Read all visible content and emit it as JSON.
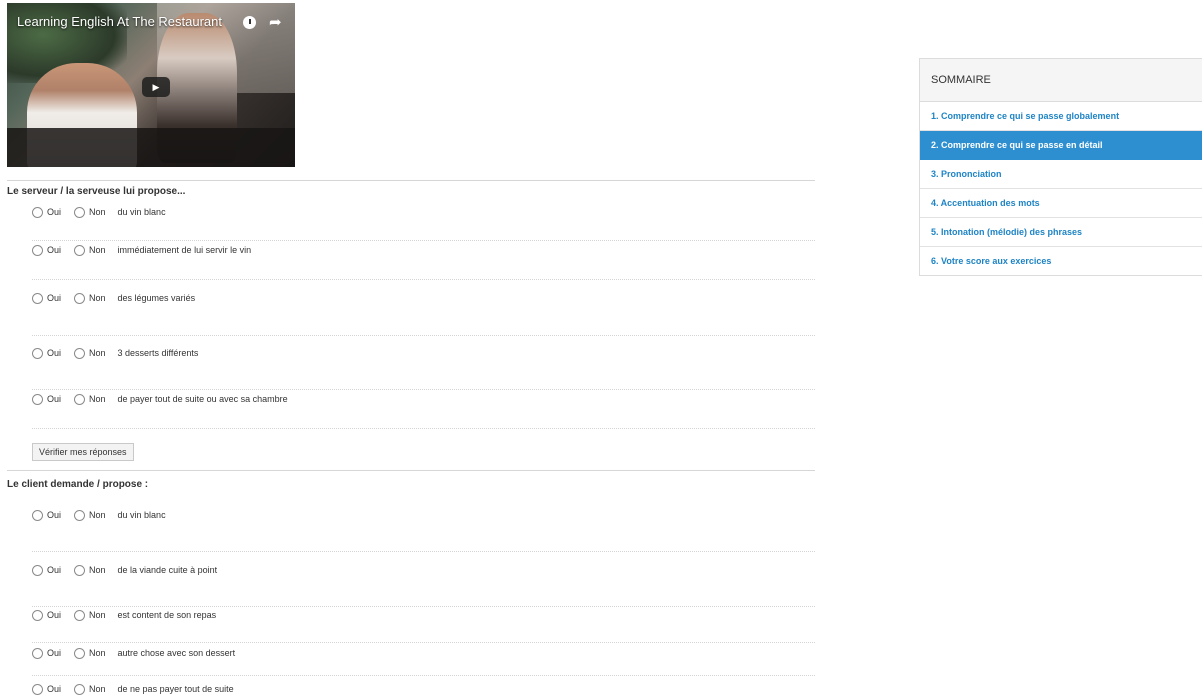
{
  "video": {
    "title": "Learning English At The Restaurant",
    "play_icon": "▶",
    "share_icon": "➦"
  },
  "section1": {
    "title": "Le serveur / la serveuse lui propose...",
    "items": [
      "du vin blanc",
      "immédiatement de lui servir le vin",
      "des légumes variés",
      "3 desserts différents",
      "de payer tout de suite ou avec sa chambre"
    ],
    "button_label": "Vérifier mes réponses"
  },
  "section2": {
    "title": "Le client demande / propose :",
    "items": [
      "du vin blanc",
      "de la viande cuite à point",
      "est content de son repas",
      "autre chose avec son dessert",
      "de ne pas payer tout de suite"
    ]
  },
  "options": {
    "yes": "Oui",
    "no": "Non"
  },
  "sidebar": {
    "title": "SOMMAIRE",
    "active_index": 1,
    "items": [
      "1. Comprendre ce qui se passe globalement",
      "2. Comprendre ce qui se passe en détail",
      "3. Prononciation",
      "4. Accentuation des mots",
      "5. Intonation (mélodie) des phrases",
      "6. Votre score aux exercices"
    ],
    "accent_color": "#2d8fd0",
    "link_color": "#1e84c5"
  }
}
